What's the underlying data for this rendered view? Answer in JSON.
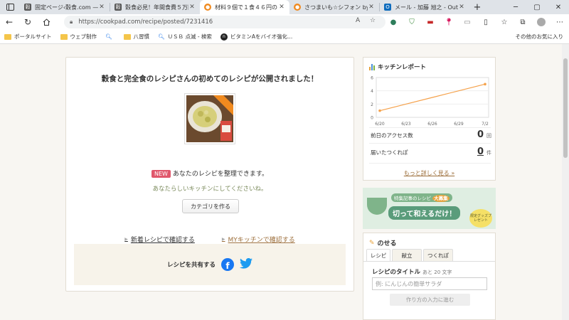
{
  "browser": {
    "tabs": [
      {
        "title": "固定ページ‹穀食.com — W",
        "fav_color": "#555555",
        "fav_glyph": "穀"
      },
      {
        "title": "穀食必見！年間食費５万円",
        "fav_color": "#555555",
        "fav_glyph": "穀"
      },
      {
        "title": "材料９個で１食４６円の",
        "fav_color": "#f08a1f",
        "fav_glyph": "●",
        "active": true
      },
      {
        "title": "さつまいも☆シフォン by kk",
        "fav_color": "#f08a1f",
        "fav_glyph": "●"
      },
      {
        "title": "メール - 加藤 旭之 - Outlo",
        "fav_color": "#0f6cbd",
        "fav_glyph": "O"
      }
    ],
    "url": "https://cookpad.com/recipe/posted/7231416",
    "bookmarks": [
      {
        "label": "ポータルサイト",
        "icon": "folder-icon"
      },
      {
        "label": "ウェブ制作",
        "icon": "folder-icon"
      },
      {
        "label": "",
        "icon": "search-icon"
      },
      {
        "label": "八習慣",
        "icon": "folder-icon"
      },
      {
        "label": "ＵＳＢ 点滅 - 検索",
        "icon": "search-icon"
      },
      {
        "label": "ビタミンAをバイオ強化...",
        "icon": "n-icon"
      }
    ],
    "other_favorites": "その他のお気に入り"
  },
  "main": {
    "headline": "穀食と完全食のレシピさんの初めてのレシピが公開されました！",
    "new_badge": "NEW",
    "new_text": "あなたのレシピを整理できます。",
    "sub_text": "あなたらしいキッチンにしてくださいね。",
    "category_button": "カテゴリを作る",
    "link_new": "新着レシピで確認する",
    "link_my": "MYキッチンで確認する",
    "share_label": "レシピを共有する"
  },
  "kitchen_report": {
    "title": "キッチンレポート",
    "access_label": "前日のアクセス数",
    "access_value": "0",
    "access_unit": "回",
    "tsukurepo_label": "届いたつくれぽ",
    "tsukurepo_value": "0",
    "tsukurepo_unit": "件",
    "more_link": "もっと詳しく見る »"
  },
  "chart_data": {
    "type": "line",
    "x": [
      "6/20",
      "6/23",
      "6/26",
      "6/29",
      "7/2"
    ],
    "series": [
      {
        "values": [
          1,
          2,
          3,
          4,
          5
        ]
      }
    ],
    "yticks": [
      0,
      2,
      4,
      6
    ],
    "ylim": [
      0,
      6
    ],
    "line_color": "#f5a14a",
    "grid": true
  },
  "banner": {
    "line1": "特集記事のレシピ",
    "line1_badge": "大募集",
    "line2": "切って和えるだけ！",
    "line3": "限定グッズプレゼント"
  },
  "nose": {
    "title": "のせる",
    "tabs": [
      "レシピ",
      "献立",
      "つくれぽ"
    ],
    "recipe_title_label": "レシピのタイトル",
    "recipe_title_hint": "あと 20 文字",
    "recipe_title_placeholder": "例: にんじんの簡単サラダ",
    "next_button": "作り方の入力に進む"
  }
}
